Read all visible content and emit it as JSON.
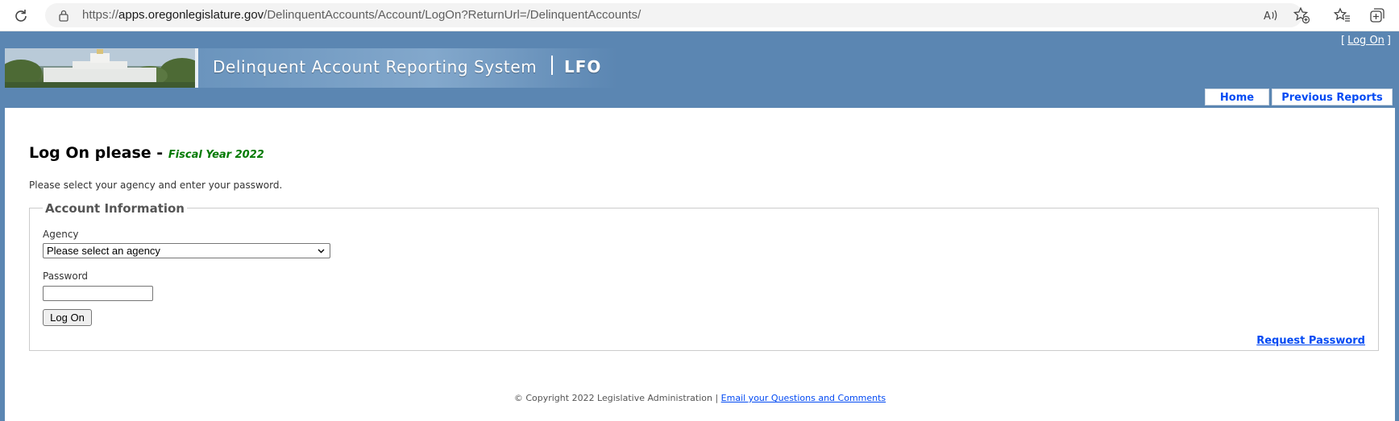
{
  "browser": {
    "url_prefix": "https://",
    "url_host": "apps.oregonlegislature.gov",
    "url_path": "/DelinquentAccounts/Account/LogOn?ReturnUrl=/DelinquentAccounts/"
  },
  "header": {
    "site_title": "Delinquent Account Reporting System",
    "site_tag": "LFO",
    "login_open": "[",
    "login_link": "Log On",
    "login_close": "]",
    "menu": [
      {
        "label": "Home"
      },
      {
        "label": "Previous Reports"
      }
    ]
  },
  "main": {
    "title": "Log On please -",
    "fiscal_year": "Fiscal Year 2022",
    "instructions": "Please select your agency and enter your password.",
    "fieldset_legend": "Account Information",
    "agency_label": "Agency",
    "agency_selected": "Please select an agency",
    "password_label": "Password",
    "password_value": "",
    "logon_button": "Log On",
    "request_password": "Request Password"
  },
  "footer": {
    "copyright": "© Copyright 2022 Legislative Administration |",
    "contact_link": "Email your Questions and Comments"
  },
  "colors": {
    "page_background": "#5b86b2",
    "link_blue": "#034af3",
    "fiscal_green": "#007a00"
  }
}
